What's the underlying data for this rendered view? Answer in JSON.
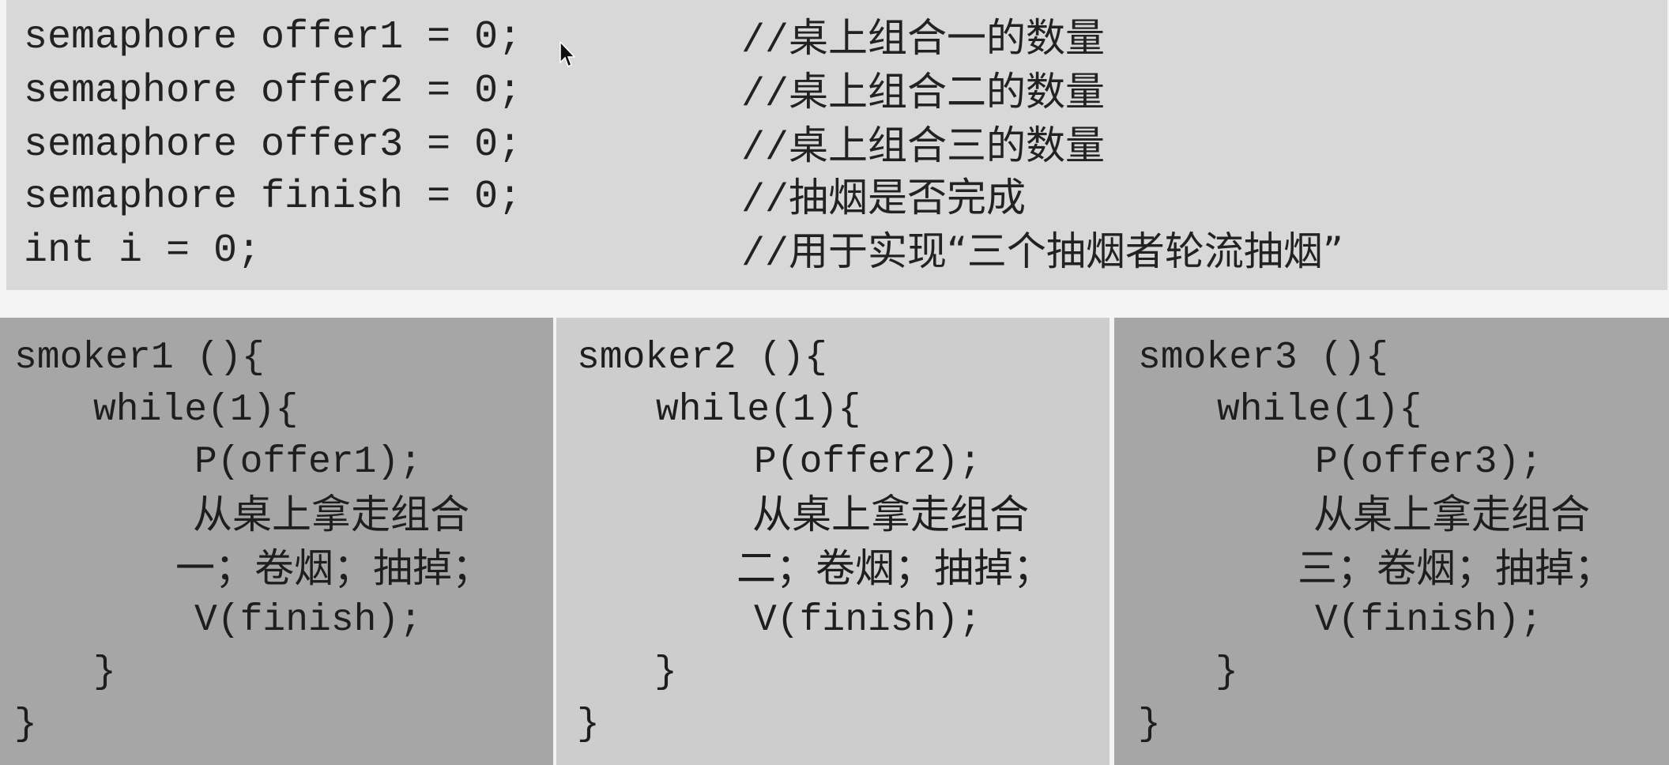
{
  "declarations": [
    {
      "code": "semaphore offer1 = 0;",
      "comment_prefix": "//",
      "comment": "桌上组合一的数量"
    },
    {
      "code": "semaphore offer2 = 0;",
      "comment_prefix": "//",
      "comment": "桌上组合二的数量"
    },
    {
      "code": "semaphore offer3 = 0;",
      "comment_prefix": "//",
      "comment": "桌上组合三的数量"
    },
    {
      "code": "semaphore finish = 0;",
      "comment_prefix": "//",
      "comment": "抽烟是否完成"
    },
    {
      "code": "int i = 0;",
      "comment_prefix": "//",
      "comment": "用于实现“三个抽烟者轮流抽烟”"
    }
  ],
  "smokers": [
    {
      "header": "smoker1 (){",
      "loop": "while(1){",
      "p_call": "P(offer1);",
      "action_line1": "从桌上拿走组合",
      "action_line2": "一；卷烟；抽掉；",
      "v_call": "V(finish);",
      "inner_close": "}",
      "outer_close": "}"
    },
    {
      "header": "smoker2 (){",
      "loop": "while(1){",
      "p_call": "P(offer2);",
      "action_line1": "从桌上拿走组合",
      "action_line2": "二；卷烟；抽掉；",
      "v_call": "V(finish);",
      "inner_close": "}",
      "outer_close": "}"
    },
    {
      "header": "smoker3 (){",
      "loop": "while(1){",
      "p_call": "P(offer3);",
      "action_line1": "从桌上拿走组合",
      "action_line2": "三；卷烟；抽掉；",
      "v_call": "V(finish);",
      "inner_close": "}",
      "outer_close": "}"
    }
  ],
  "colors": {
    "top_background": "#d8d8d8",
    "panel_dark": "#a6a6a6",
    "panel_light": "#cdcdcd",
    "text": "#222222"
  },
  "icons": {
    "cursor": "mouse-pointer-icon"
  }
}
